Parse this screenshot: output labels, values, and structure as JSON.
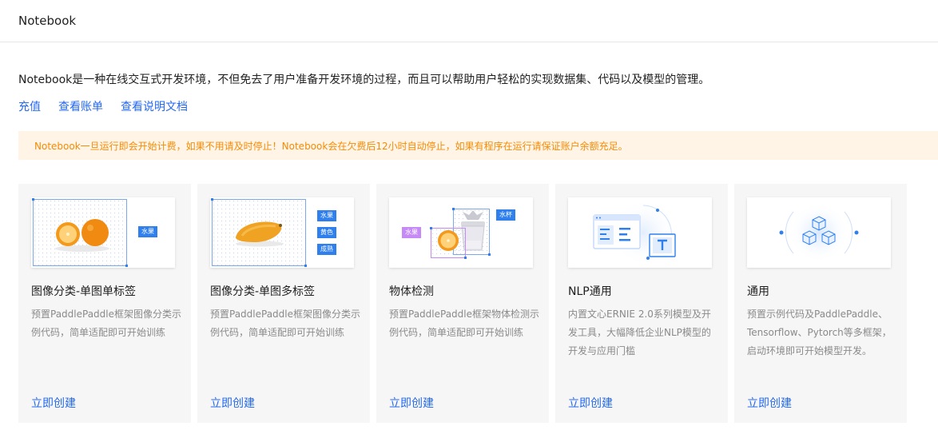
{
  "header": {
    "title": "Notebook"
  },
  "intro": {
    "text": "Notebook是一种在线交互式开发环境，不但免去了用户准备开发环境的过程，而且可以帮助用户轻松的实现数据集、代码以及模型的管理。"
  },
  "links": [
    {
      "label": "充值"
    },
    {
      "label": "查看账单"
    },
    {
      "label": "查看说明文档"
    }
  ],
  "notice": {
    "text": "Notebook一旦运行即会开始计费，如果不用请及时停止！Notebook会在欠费后12小时自动停止，如果有程序在运行请保证账户余额充足。"
  },
  "colors": {
    "link": "#2468f2",
    "notice_bg": "#fff4e6",
    "notice_text": "#f48c06",
    "tag": "#2f80ed",
    "tag_purple": "#c58af5"
  },
  "cards": [
    {
      "title": "图像分类-单图单标签",
      "desc": "预置PaddlePaddle框架图像分类示例代码，简单适配即可开始训练",
      "action": "立即创建",
      "tags": [
        "水果"
      ]
    },
    {
      "title": "图像分类-单图多标签",
      "desc": "预置PaddlePaddle框架图像分类示例代码，简单适配即可开始训练",
      "action": "立即创建",
      "tags": [
        "水果",
        "黄色",
        "成熟"
      ]
    },
    {
      "title": "物体检测",
      "desc": "预置PaddlePaddle框架物体检测示例代码，简单适配即可开始训练",
      "action": "立即创建",
      "tags": [
        "水杯",
        "水果"
      ]
    },
    {
      "title": "NLP通用",
      "desc": "内置文心ERNIE 2.0系列模型及开发工具，大幅降低企业NLP模型的开发与应用门槛",
      "action": "立即创建",
      "tags": []
    },
    {
      "title": "通用",
      "desc": "预置示例代码及PaddlePaddle、Tensorflow、Pytorch等多框架，启动环境即可开始模型开发。",
      "action": "立即创建",
      "tags": []
    }
  ]
}
